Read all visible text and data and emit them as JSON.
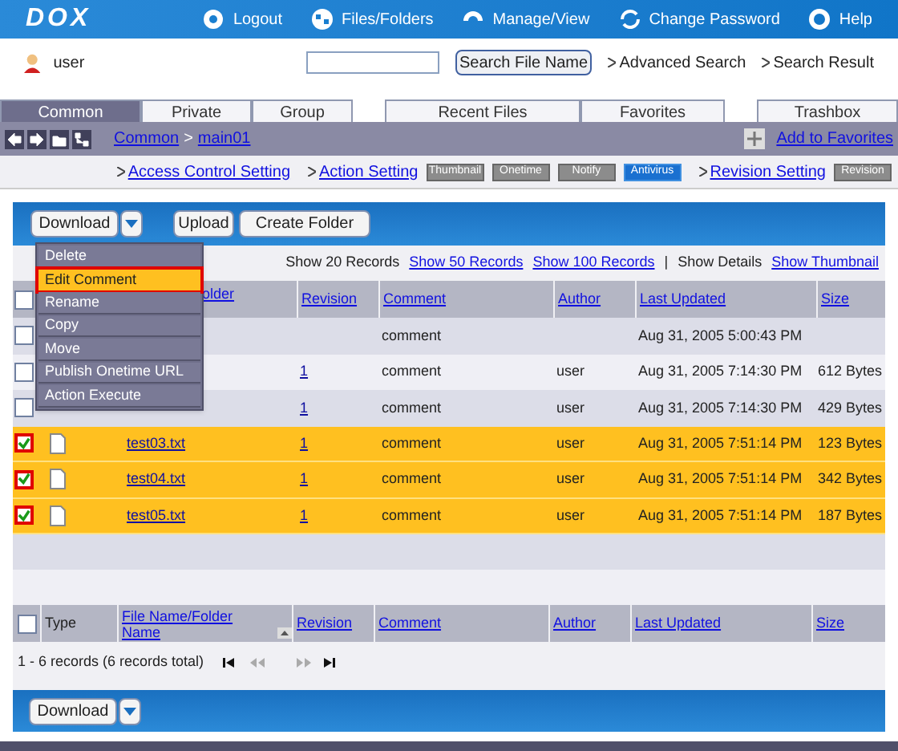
{
  "header": {
    "logo": "DOX",
    "nav": [
      {
        "kind": "logout",
        "label": "Logout"
      },
      {
        "kind": "files",
        "label": "Files/Folders"
      },
      {
        "kind": "manage",
        "label": "Manage/View"
      },
      {
        "kind": "password",
        "label": "Change Password"
      },
      {
        "kind": "help",
        "label": "Help"
      }
    ]
  },
  "user": {
    "name": "user",
    "search_button": "Search File Name",
    "links": [
      "Advanced Search",
      "Search Result"
    ]
  },
  "tab_groups": [
    [
      {
        "label": "Common",
        "selected": true
      },
      {
        "label": "Private",
        "selected": false
      },
      {
        "label": "Group",
        "selected": false
      }
    ],
    [
      {
        "label": "Recent Files",
        "selected": false
      },
      {
        "label": "Favorites",
        "selected": false
      }
    ],
    [
      {
        "label": "Trashbox",
        "selected": false
      }
    ]
  ],
  "breadcrumb": {
    "path": [
      "Common",
      "main01"
    ],
    "separator": ">",
    "add_favorites": "Add to Favorites"
  },
  "settings": [
    {
      "kind": "link",
      "label": "Access Control Setting"
    },
    {
      "kind": "link",
      "label": "Action Setting"
    },
    {
      "kind": "badge",
      "label": "Thumbnail",
      "on": false
    },
    {
      "kind": "badge",
      "label": "Onetime",
      "on": false
    },
    {
      "kind": "badge",
      "label": "Notify",
      "on": false
    },
    {
      "kind": "badge",
      "label": "Antivirus",
      "on": true
    },
    {
      "kind": "link",
      "label": "Revision Setting"
    },
    {
      "kind": "badge",
      "label": "Revision",
      "on": false
    }
  ],
  "toolbar": {
    "download": "Download",
    "upload": "Upload",
    "create_folder": "Create Folder"
  },
  "menu": [
    {
      "label": "Delete",
      "selected": false
    },
    {
      "label": "Edit Comment",
      "selected": true
    },
    {
      "label": "Rename",
      "selected": false
    },
    {
      "label": "Copy",
      "selected": false
    },
    {
      "label": "Move",
      "selected": false
    },
    {
      "label": "Publish Onetime URL",
      "selected": false
    },
    {
      "label": "Action Execute",
      "selected": false
    }
  ],
  "records": {
    "current": "Show 20 Records",
    "links": [
      "Show 50 Records",
      "Show 100 Records"
    ],
    "separator": "|",
    "details": "Show Details",
    "thumbnail": "Show Thumbnail"
  },
  "top_header": {
    "checked": false,
    "columns": [
      "older",
      "Revision",
      "Comment",
      "Author",
      "Last Updated",
      "Size"
    ]
  },
  "rows": [
    {
      "checked": false,
      "comment": "comment",
      "updated": "Aug 31, 2005 5:00:43 PM"
    },
    {
      "checked": false,
      "revision": "1",
      "comment": "comment",
      "author": "user",
      "updated": "Aug 31, 2005 7:14:30 PM",
      "size": "612 Bytes"
    },
    {
      "checked": false,
      "revision": "1",
      "comment": "comment",
      "author": "user",
      "updated": "Aug 31, 2005 7:14:30 PM",
      "size": "429 Bytes"
    },
    {
      "checked": true,
      "icon": true,
      "name": "test03.txt",
      "revision": "1",
      "comment": "comment",
      "author": "user",
      "updated": "Aug 31, 2005 7:51:14 PM",
      "size": "123 Bytes"
    },
    {
      "checked": true,
      "icon": true,
      "name": "test04.txt",
      "revision": "1",
      "comment": "comment",
      "author": "user",
      "updated": "Aug 31, 2005 7:51:14 PM",
      "size": "342 Bytes"
    },
    {
      "checked": true,
      "icon": true,
      "name": "test05.txt",
      "revision": "1",
      "comment": "comment",
      "author": "user",
      "updated": "Aug 31, 2005 7:51:14 PM",
      "size": "187 Bytes"
    }
  ],
  "bottom_header": {
    "checked": false,
    "columns": [
      "Type",
      "File Name/Folder Name",
      "Revision",
      "Comment",
      "Author",
      "Last Updated",
      "Size"
    ]
  },
  "pagination": {
    "summary": "1 - 6 records (6 records total)",
    "controls": [
      {
        "kind": "first",
        "disabled": false
      },
      {
        "kind": "prev",
        "disabled": true
      },
      {
        "kind": "next",
        "disabled": true
      },
      {
        "kind": "last",
        "disabled": false
      }
    ]
  },
  "bottom_toolbar": {
    "download": "Download"
  }
}
